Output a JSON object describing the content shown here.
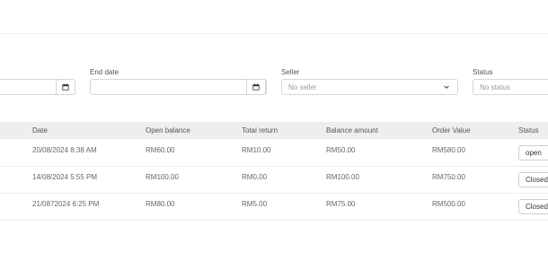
{
  "filters": {
    "end_date_label": "End date",
    "seller_label": "Seller",
    "seller_placeholder": "No seller",
    "status_label": "Status",
    "status_placeholder": "No status"
  },
  "table": {
    "columns": [
      "Date",
      "Open balance",
      "Total return",
      "Balance amount",
      "Order Value",
      "Status"
    ],
    "rows": [
      {
        "date": "20/08/2024 8:38 AM",
        "open_balance": "RM60.00",
        "total_return": "RM10.00",
        "balance_amount": "RM50.00",
        "order_value": "RM580.00",
        "status": "open"
      },
      {
        "date": "14/08/2024 5:55 PM",
        "open_balance": "RM100.00",
        "total_return": "RM0.00",
        "balance_amount": "RM100.00",
        "order_value": "RM750.00",
        "status": "Closed"
      },
      {
        "date": "21/0872024 6:25 PM",
        "open_balance": "RM80.00",
        "total_return": "RM5.00",
        "balance_amount": "RM75.00",
        "order_value": "RM500.00",
        "status": "Closed"
      }
    ]
  },
  "icons": {
    "date_picker": "calendar-icon",
    "dropdown": "chevron-down-icon"
  }
}
